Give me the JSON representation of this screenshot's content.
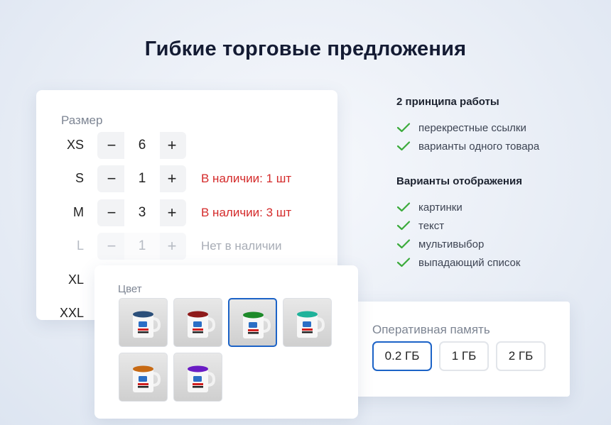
{
  "title": "Гибкие торговые предложения",
  "size_card": {
    "label": "Размер",
    "rows": [
      {
        "size": "XS",
        "qty": "6",
        "minus": "−",
        "plus": "+",
        "stock": "",
        "stock_state": "none"
      },
      {
        "size": "S",
        "qty": "1",
        "minus": "−",
        "plus": "+",
        "stock": "В наличии: 1 шт",
        "stock_state": "in"
      },
      {
        "size": "M",
        "qty": "3",
        "minus": "−",
        "plus": "+",
        "stock": "В наличии: 3 шт",
        "stock_state": "in"
      },
      {
        "size": "L",
        "qty": "1",
        "minus": "−",
        "plus": "+",
        "stock": "Нет в наличии",
        "stock_state": "out"
      },
      {
        "size": "XL",
        "qty": "",
        "minus": "",
        "plus": "",
        "stock": "",
        "stock_state": "none"
      },
      {
        "size": "XXL",
        "qty": "",
        "minus": "",
        "plus": "",
        "stock": "",
        "stock_state": "none"
      }
    ]
  },
  "color_card": {
    "label": "Цвет",
    "swatches": [
      {
        "name": "blue",
        "rim": "#2b4f7a",
        "selected": false
      },
      {
        "name": "red",
        "rim": "#8e1a1a",
        "selected": false
      },
      {
        "name": "green",
        "rim": "#1d8a2a",
        "selected": true
      },
      {
        "name": "teal",
        "rim": "#1fb29a",
        "selected": false
      },
      {
        "name": "orange",
        "rim": "#c76a14",
        "selected": false
      },
      {
        "name": "purple",
        "rim": "#6a1cc4",
        "selected": false
      }
    ]
  },
  "ram_card": {
    "label": "Оперативная память",
    "options": [
      {
        "label": "0.2 ГБ",
        "selected": true
      },
      {
        "label": "1 ГБ",
        "selected": false
      },
      {
        "label": "2 ГБ",
        "selected": false
      }
    ]
  },
  "info": {
    "principles_title": "2 принципа работы",
    "principles": [
      "перекрестные ссылки",
      "варианты одного товара"
    ],
    "display_title": "Варианты отображения",
    "display": [
      "картинки",
      "текст",
      "мультивыбор",
      "выпадающий список"
    ]
  },
  "colors": {
    "accent": "#1c63c7",
    "in_stock": "#d42a2a",
    "check": "#3aaa3a",
    "title": "#141b33"
  }
}
